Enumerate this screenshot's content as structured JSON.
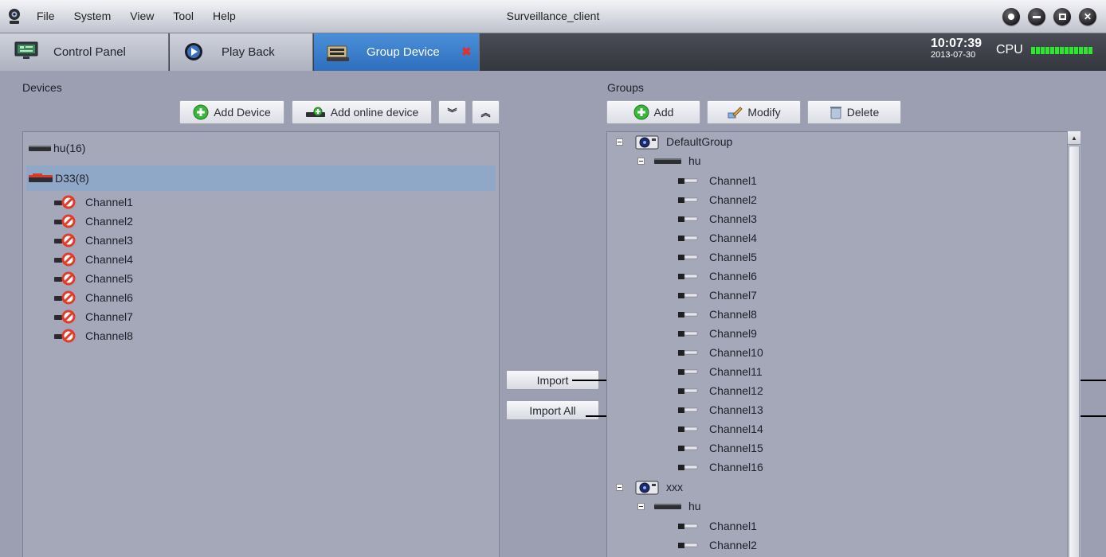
{
  "menu": {
    "items": [
      "File",
      "System",
      "View",
      "Tool",
      "Help"
    ]
  },
  "app": {
    "title": "Surveillance_client"
  },
  "tabs": [
    {
      "label": "Control Panel"
    },
    {
      "label": "Play Back"
    },
    {
      "label": "Group Device"
    }
  ],
  "status": {
    "time": "10:07:39",
    "date": "2013-07-30",
    "cpu_label": "CPU"
  },
  "devices": {
    "heading": "Devices",
    "add_device_label": "Add Device",
    "add_online_label": "Add online device",
    "tree": [
      {
        "label": "hu(16)"
      },
      {
        "label": "D33(8)"
      }
    ],
    "channels": [
      "Channel1",
      "Channel2",
      "Channel3",
      "Channel4",
      "Channel5",
      "Channel6",
      "Channel7",
      "Channel8"
    ]
  },
  "middle": {
    "import_label": "Import",
    "import_all_label": "Import All"
  },
  "groups": {
    "heading": "Groups",
    "add_label": "Add",
    "modify_label": "Modify",
    "delete_label": "Delete",
    "group1": {
      "name": "DefaultGroup",
      "device": "hu",
      "channels": [
        "Channel1",
        "Channel2",
        "Channel3",
        "Channel4",
        "Channel5",
        "Channel6",
        "Channel7",
        "Channel8",
        "Channel9",
        "Channel10",
        "Channel11",
        "Channel12",
        "Channel13",
        "Channel14",
        "Channel15",
        "Channel16"
      ]
    },
    "group2": {
      "name": "xxx",
      "device": "hu",
      "channels": [
        "Channel1",
        "Channel2"
      ]
    }
  },
  "colors": {
    "active_tab": "#2f6fbe",
    "cpu_meter": "#2ee62e",
    "selected_row": "#8fa8c8"
  }
}
